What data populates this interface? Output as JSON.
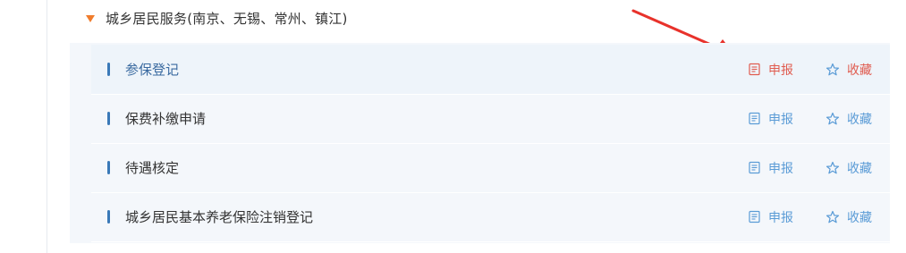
{
  "section": {
    "title": "城乡居民服务(南京、无锡、常州、镇江)"
  },
  "rows": [
    {
      "label": "参保登记",
      "declare_label": "申报",
      "favorite_label": "收藏"
    },
    {
      "label": "保费补缴申请",
      "declare_label": "申报",
      "favorite_label": "收藏"
    },
    {
      "label": "待遇核定",
      "declare_label": "申报",
      "favorite_label": "收藏"
    },
    {
      "label": "城乡居民基本养老保险注销登记",
      "declare_label": "申报",
      "favorite_label": "收藏"
    }
  ],
  "colors": {
    "caret": "#f07c2c",
    "row_marker": "#3a79b8",
    "action_default": "#5a9bd6",
    "action_highlight": "#e05b4f",
    "annotation_arrow": "#e8322b"
  },
  "icons": {
    "expand": "caret-down-icon",
    "declare": "document-icon",
    "favorite": "star-icon",
    "annotation": "red-arrow-icon"
  }
}
